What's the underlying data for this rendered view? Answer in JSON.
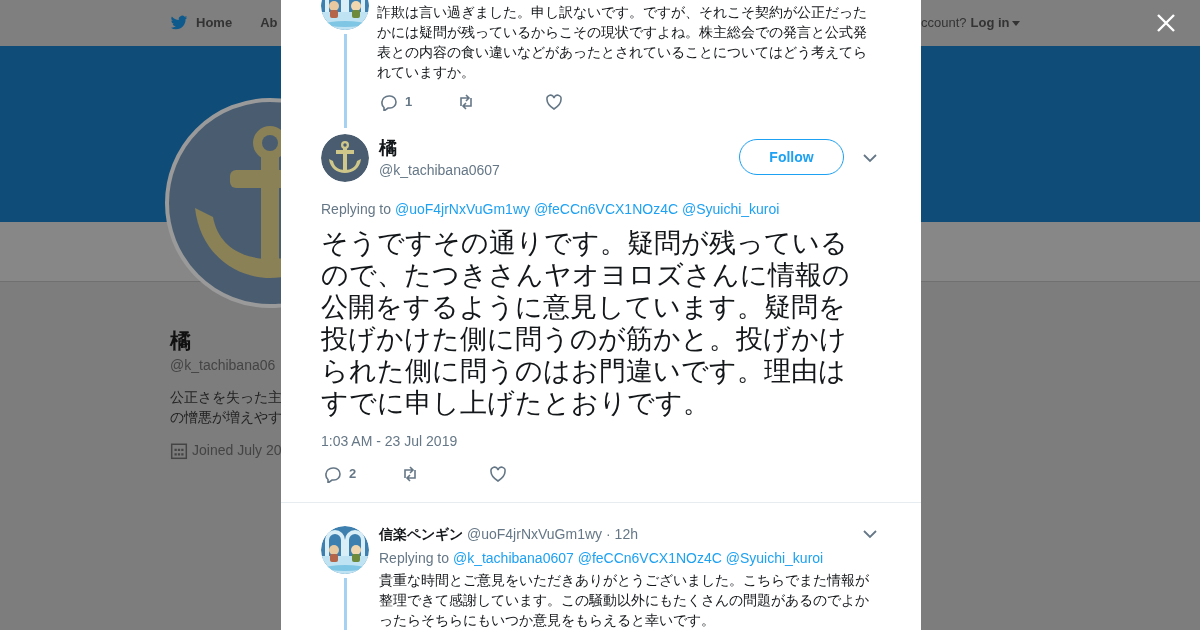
{
  "background_page": {
    "nav": {
      "items": [
        {
          "label": "Home"
        },
        {
          "label": "Ab"
        }
      ],
      "login_prompt": "ccount?",
      "login_link": "Log in"
    },
    "profile": {
      "name": "橘",
      "handle": "@k_tachibana06",
      "bio_lines": [
        "公正さを失った主",
        "の憎悪が増えやす"
      ],
      "joined": "Joined July 20"
    }
  },
  "parent_tweet": {
    "text": "詐欺は言い過ぎました。申し訳ないです。ですが、それこそ契約が公正だったかには疑問が残っているからこその現状ですよね。株主総会での発言と公式発表との内容の食い違いなどがあったとされていることについてはどう考えてられていますか。",
    "reply_count": "1"
  },
  "main_tweet": {
    "name": "橘",
    "handle": "@k_tachibana0607",
    "follow_button": "Follow",
    "replying_label": "Replying to",
    "mentions": [
      "@uoF4jrNxVuGm1wy",
      "@feCCn6VCX1NOz4C",
      "@Syuichi_kuroi"
    ],
    "text": "そうですその通りです。疑問が残っているので、たつきさんヤオヨロズさんに情報の公開をするように意見しています。疑問を投げかけた側に問うのが筋かと。投げかけられた側に問うのはお門違いです。理由はすでに申し上げたとおりです。",
    "timestamp": "1:03 AM - 23 Jul 2019",
    "reply_count": "2"
  },
  "replies": [
    {
      "name": "信楽ペンギン",
      "handle": "@uoF4jrNxVuGm1wy",
      "time": "· 12h",
      "replying_label": "Replying to",
      "mentions": [
        "@k_tachibana0607",
        "@feCCn6VCX1NOz4C",
        "@Syuichi_kuroi"
      ],
      "text": "貴重な時間とご意見をいただきありがとうございました。こちらでまた情報が整理できて感謝しています。この騒動以外にもたくさんの問題があるのでよかったらそちらにもいつか意見をもらえると幸いです。"
    }
  ]
}
